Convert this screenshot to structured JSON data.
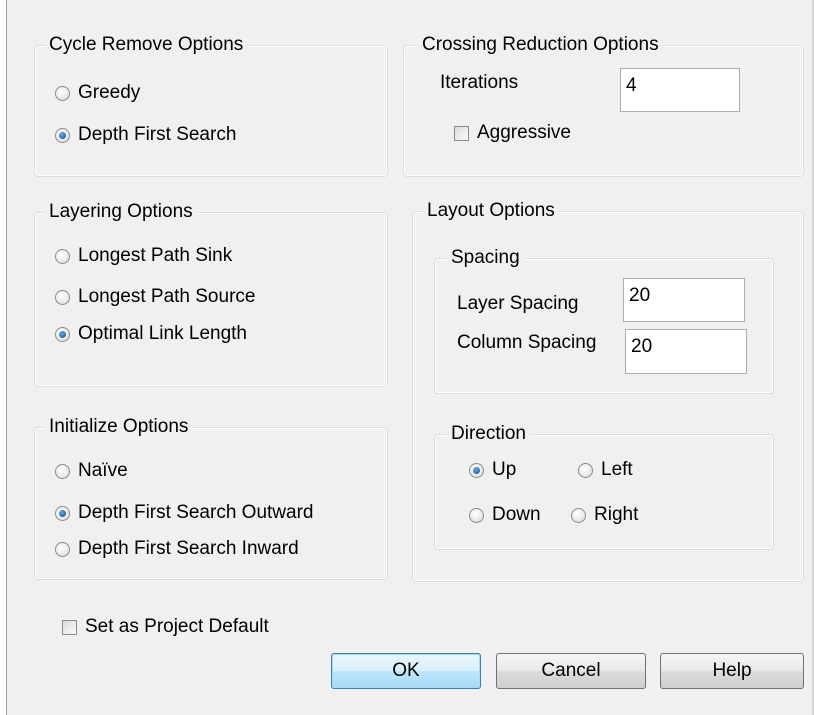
{
  "cycle_remove": {
    "title": "Cycle Remove Options",
    "options": [
      {
        "label": "Greedy",
        "checked": false
      },
      {
        "label": "Depth First Search",
        "checked": true
      }
    ]
  },
  "crossing": {
    "title": "Crossing Reduction Options",
    "iterations_label": "Iterations",
    "iterations_value": "4",
    "aggressive_label": "Aggressive",
    "aggressive_checked": false
  },
  "layering": {
    "title": "Layering Options",
    "options": [
      {
        "label": "Longest Path Sink",
        "checked": false
      },
      {
        "label": "Longest Path Source",
        "checked": false
      },
      {
        "label": "Optimal Link Length",
        "checked": true
      }
    ]
  },
  "initialize": {
    "title": "Initialize Options",
    "options": [
      {
        "label": "Naïve",
        "checked": false
      },
      {
        "label": "Depth First Search Outward",
        "checked": true
      },
      {
        "label": "Depth First Search Inward",
        "checked": false
      }
    ]
  },
  "layout": {
    "title": "Layout Options",
    "spacing": {
      "title": "Spacing",
      "layer_label": "Layer Spacing",
      "layer_value": "20",
      "column_label": "Column Spacing",
      "column_value": "20"
    },
    "direction": {
      "title": "Direction",
      "options": [
        {
          "label": "Up",
          "checked": true
        },
        {
          "label": "Left",
          "checked": false
        },
        {
          "label": "Down",
          "checked": false
        },
        {
          "label": "Right",
          "checked": false
        }
      ]
    }
  },
  "project_default": {
    "label": "Set as Project Default",
    "checked": false
  },
  "buttons": {
    "ok": "OK",
    "cancel": "Cancel",
    "help": "Help"
  }
}
